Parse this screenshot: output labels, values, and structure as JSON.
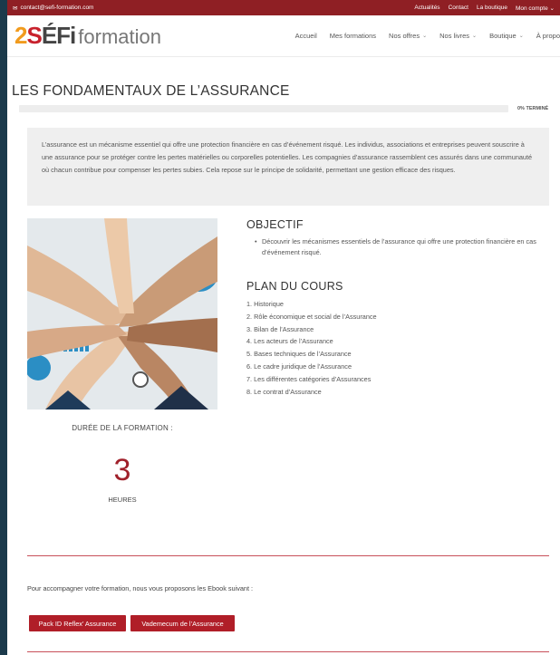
{
  "topbar": {
    "email": "contact@sefi-formation.com",
    "links": [
      "Actualités",
      "Contact",
      "La boutique",
      "Mon compte"
    ]
  },
  "logo": {
    "mark_a": "2",
    "mark_b": "S",
    "mark_c": "ÉFi",
    "word": "formation"
  },
  "nav": {
    "items": [
      "Accueil",
      "Mes formations",
      "Nos offres",
      "Nos livres",
      "Boutique",
      "À propo"
    ]
  },
  "page": {
    "title": "LES FONDAMENTAUX DE L’ASSURANCE",
    "progress_percent": 0,
    "progress_label": "0% TERMINÉ",
    "intro": "L’assurance est un mécanisme essentiel qui offre une protection financière en cas d’événement risqué. Les individus, associations et entreprises peuvent souscrire à une assurance pour se protéger contre les pertes matérielles ou corporelles potentielles. Les compagnies d’assurance rassemblent ces assurés dans une communauté où chacun contribue pour compenser les pertes subies. Cela repose sur le principe de solidarité, permettant une gestion efficace des risques."
  },
  "duration": {
    "label": "DURÉE DE LA FORMATION :",
    "value": "3",
    "unit": "HEURES"
  },
  "objectif": {
    "title": "OBJECTIF",
    "items": [
      "Découvrir les mécanismes essentiels de l’assurance qui offre une protection financière en cas d’événement risqué."
    ]
  },
  "plan": {
    "title": "PLAN DU COURS",
    "items": [
      "1. Historique",
      "2. Rôle économique et social de l’Assurance",
      "3. Bilan de l’Assurance",
      "4. Les acteurs de l’Assurance",
      "5. Bases techniques de l’Assurance",
      "6. Le cadre juridique de l’Assurance",
      "7. Les différentes catégories d’Assurances",
      "8. Le contrat d’Assurance"
    ]
  },
  "ebook": {
    "text": "Pour accompagner votre formation, nous vous proposons les Ebook suivant :",
    "buttons": [
      "Pack ID Reflex’ Assurance",
      "Vademecum de l’Assurance"
    ]
  },
  "colors": {
    "accent": "#8f1f24",
    "button": "#b01e28",
    "duration": "#a0202a"
  }
}
